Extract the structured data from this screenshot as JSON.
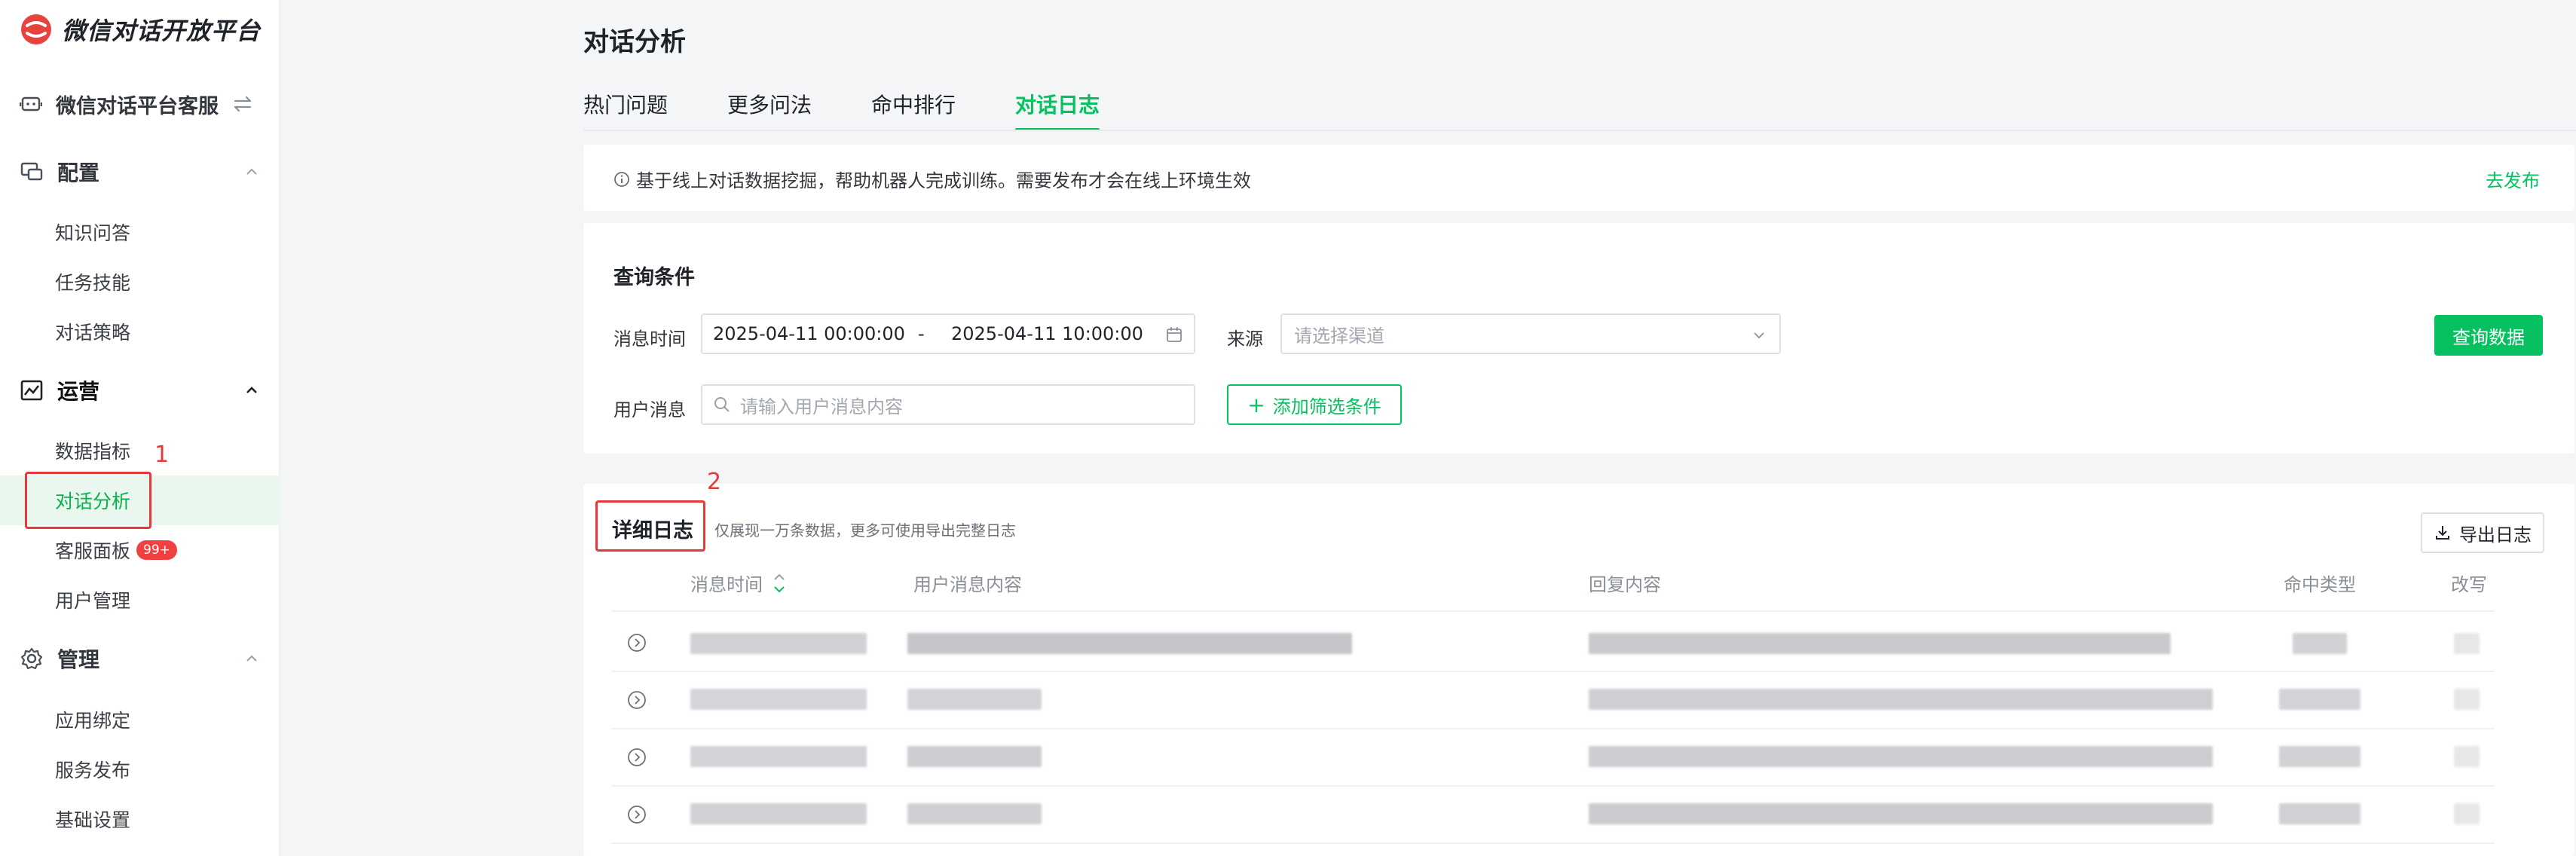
{
  "app": {
    "brand_name": "微信对话开放平台",
    "service_name": "微信对话平台客服"
  },
  "sidebar": {
    "groups": [
      {
        "label": "配置",
        "icon": "config-icon",
        "expanded": true,
        "items": [
          "知识问答",
          "任务技能",
          "对话策略"
        ]
      },
      {
        "label": "运营",
        "icon": "operations-icon",
        "expanded": true,
        "items": [
          "数据指标",
          "对话分析",
          "客服面板",
          "用户管理"
        ]
      },
      {
        "label": "管理",
        "icon": "settings-icon",
        "expanded": true,
        "items": [
          "应用绑定",
          "服务发布",
          "基础设置"
        ]
      }
    ],
    "selected_item": "对话分析",
    "badge": "99+"
  },
  "annotations": {
    "one": "1",
    "two": "2"
  },
  "page": {
    "title": "对话分析",
    "tabs": [
      "热门问题",
      "更多问法",
      "命中排行",
      "对话日志"
    ],
    "active_tab": "对话日志"
  },
  "notice": {
    "text": "基于线上对话数据挖掘，帮助机器人完成训练。需要发布才会在线上环境生效",
    "action": "去发布"
  },
  "query": {
    "title": "查询条件",
    "time_label": "消息时间",
    "time_start": "2025-04-11 00:00:00",
    "time_sep": "-",
    "time_end": "2025-04-11 10:00:00",
    "source_label": "来源",
    "source_placeholder": "请选择渠道",
    "msg_label": "用户消息",
    "msg_placeholder": "请输入用户消息内容",
    "add_filter": "添加筛选条件",
    "search_button": "查询数据"
  },
  "logs": {
    "title": "详细日志",
    "hint": "仅展现一万条数据，更多可使用导出完整日志",
    "export_button": "导出日志",
    "columns": [
      "消息时间",
      "用户消息内容",
      "回复内容",
      "命中类型",
      "改写"
    ],
    "rows_blurred": 4
  },
  "colors": {
    "accent": "#07c160",
    "annotation": "#e43a3a",
    "selected_bg": "#e9f7ee"
  }
}
